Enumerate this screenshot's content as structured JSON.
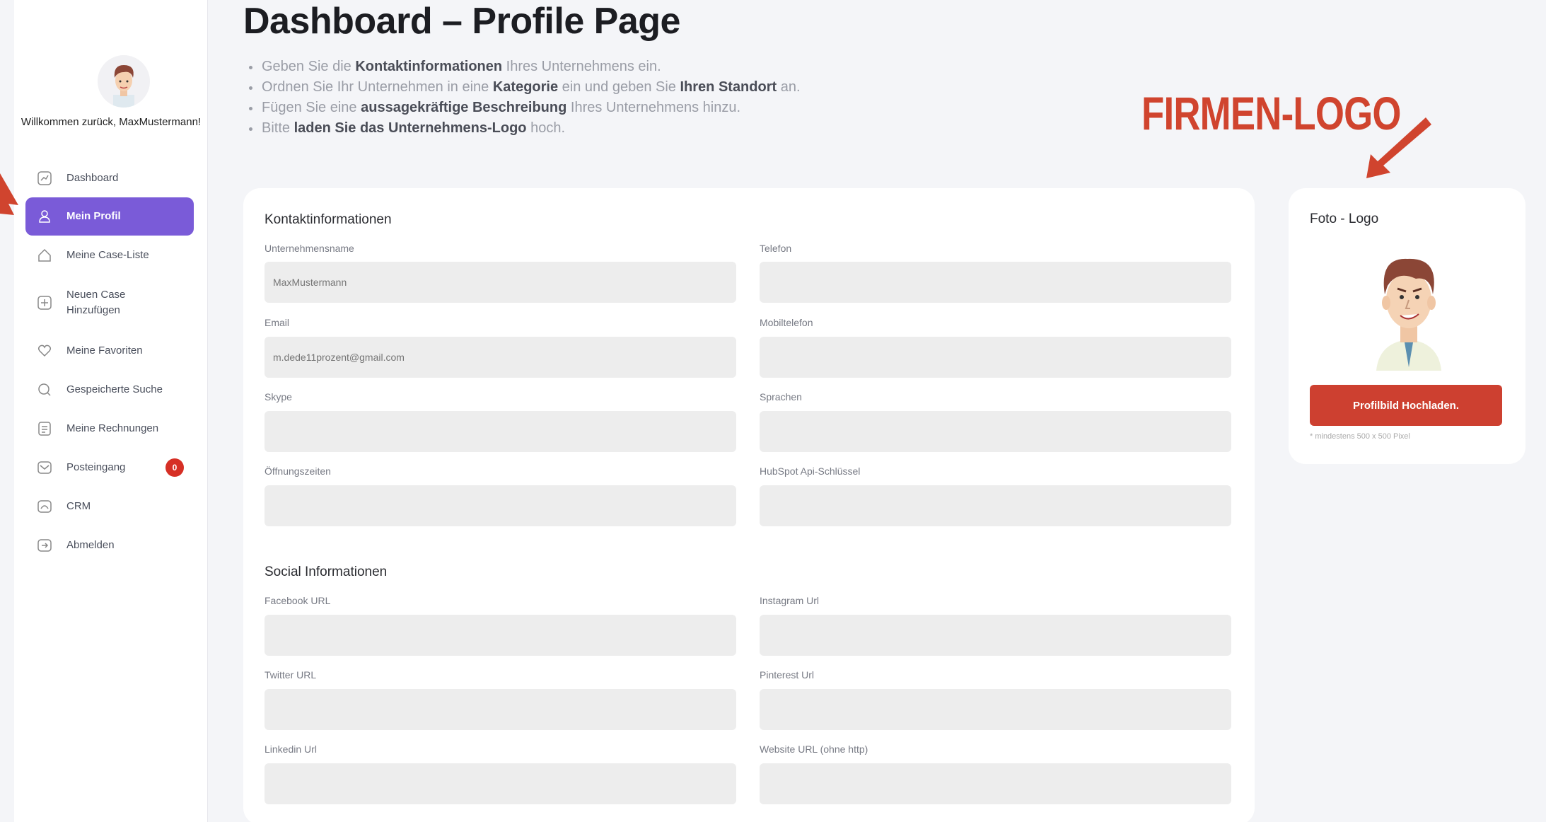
{
  "sidebar": {
    "welcome": "Willkommen zurück, MaxMustermann!",
    "items": [
      {
        "label": "Dashboard",
        "icon": "chart-icon"
      },
      {
        "label": "Mein Profil",
        "icon": "user-icon"
      },
      {
        "label": "Meine Case-Liste",
        "icon": "home-icon"
      },
      {
        "label": "Neuen Case Hinzufügen",
        "icon": "plus-icon"
      },
      {
        "label": "Meine Favoriten",
        "icon": "heart-icon"
      },
      {
        "label": "Gespeicherte Suche",
        "icon": "search-icon"
      },
      {
        "label": "Meine Rechnungen",
        "icon": "invoice-icon"
      },
      {
        "label": "Posteingang",
        "icon": "inbox-icon",
        "badge": "0"
      },
      {
        "label": "CRM",
        "icon": "crm-icon"
      },
      {
        "label": "Abmelden",
        "icon": "logout-icon"
      }
    ]
  },
  "header": {
    "title": "Dashboard – Profile Page",
    "bullets": [
      {
        "pre": "Geben Sie die ",
        "bold": "Kontaktinformationen",
        "mid": " Ihres Unternehmens ein.",
        "bold2": "",
        "post": ""
      },
      {
        "pre": "Ordnen Sie Ihr Unternehmen in eine ",
        "bold": "Kategorie",
        "mid": " ein und geben Sie ",
        "bold2": "Ihren Standort",
        "post": " an."
      },
      {
        "pre": "Fügen Sie eine ",
        "bold": "aussagekräftige Beschreibung",
        "mid": " Ihres Unternehmens hinzu.",
        "bold2": "",
        "post": ""
      },
      {
        "pre": "Bitte ",
        "bold": "laden Sie das Unternehmens-Logo",
        "mid": " hoch.",
        "bold2": "",
        "post": ""
      }
    ]
  },
  "annotation": {
    "label": "FIRMEN-LOGO",
    "color": "#d0442e"
  },
  "form": {
    "contact_title": "Kontaktinformationen",
    "social_title": "Social Informationen",
    "fields": {
      "company_name": {
        "label": "Unternehmensname",
        "placeholder": "MaxMustermann"
      },
      "phone": {
        "label": "Telefon",
        "placeholder": ""
      },
      "email": {
        "label": "Email",
        "placeholder": "m.dede11prozent@gmail.com"
      },
      "mobile": {
        "label": "Mobiltelefon",
        "placeholder": ""
      },
      "skype": {
        "label": "Skype",
        "placeholder": ""
      },
      "languages": {
        "label": "Sprachen",
        "placeholder": ""
      },
      "opening_hours": {
        "label": "Öffnungszeiten",
        "placeholder": ""
      },
      "hubspot": {
        "label": "HubSpot Api-Schlüssel",
        "placeholder": ""
      },
      "facebook": {
        "label": "Facebook URL",
        "placeholder": ""
      },
      "instagram": {
        "label": "Instagram Url",
        "placeholder": ""
      },
      "twitter": {
        "label": "Twitter URL",
        "placeholder": ""
      },
      "pinterest": {
        "label": "Pinterest Url",
        "placeholder": ""
      },
      "linkedin": {
        "label": "Linkedin Url",
        "placeholder": ""
      },
      "website": {
        "label": "Website URL (ohne http)",
        "placeholder": ""
      }
    }
  },
  "photo": {
    "title": "Foto - Logo",
    "upload_label": "Profilbild Hochladen.",
    "hint": "* mindestens 500 x 500 Pixel"
  },
  "colors": {
    "accent": "#7a5bd8",
    "upload": "#cd4030",
    "badge": "#d62f25"
  }
}
